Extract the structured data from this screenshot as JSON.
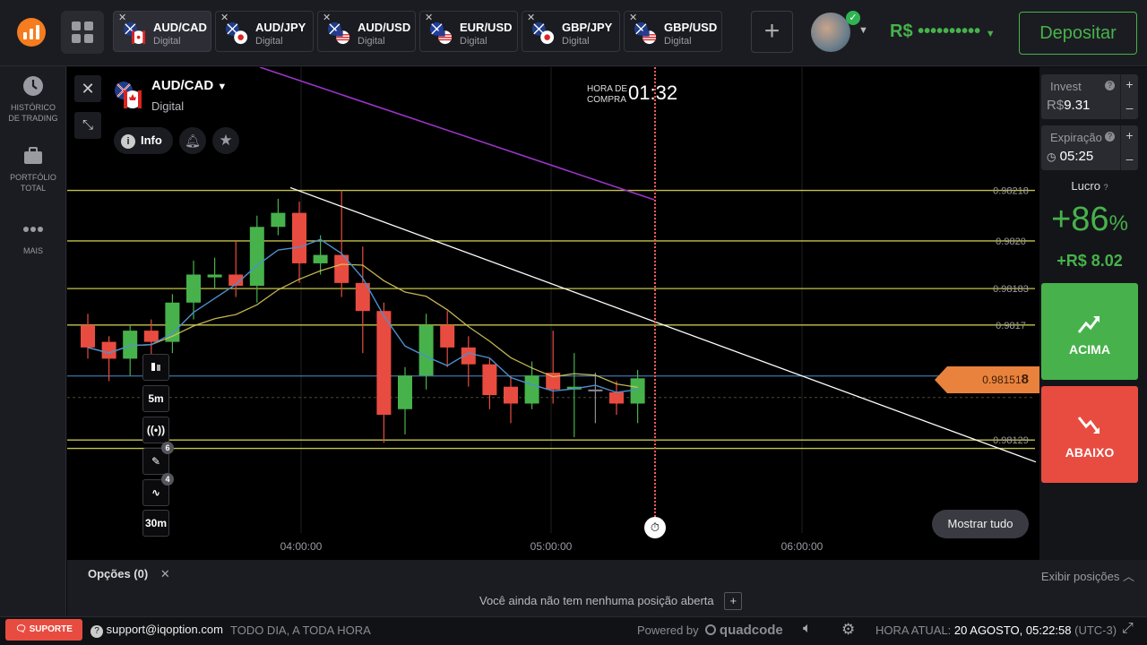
{
  "header": {
    "tabs": [
      {
        "pair": "AUD/CAD",
        "kind": "Digital",
        "active": true
      },
      {
        "pair": "AUD/JPY",
        "kind": "Digital",
        "active": false
      },
      {
        "pair": "AUD/USD",
        "kind": "Digital",
        "active": false
      },
      {
        "pair": "EUR/USD",
        "kind": "Digital",
        "active": false
      },
      {
        "pair": "GBP/JPY",
        "kind": "Digital",
        "active": false
      },
      {
        "pair": "GBP/USD",
        "kind": "Digital",
        "active": false
      }
    ],
    "balance": "R$ ••••••••••",
    "deposit_label": "Depositar"
  },
  "sidebar": {
    "items": [
      {
        "label_line1": "HISTÓRICO",
        "label_line2": "DE TRADING",
        "icon": "clock-icon"
      },
      {
        "label_line1": "PORTFÓLIO",
        "label_line2": "TOTAL",
        "icon": "briefcase-icon"
      },
      {
        "label_line1": "MAIS",
        "label_line2": "",
        "icon": "more-icon"
      }
    ]
  },
  "chart": {
    "asset": "AUD/CAD",
    "asset_kind": "Digital",
    "info_label": "Info",
    "purchase_label_1": "HORA DE",
    "purchase_label_2": "COMPRA",
    "purchase_timer": "01:32",
    "current_price_main": "0.98151",
    "current_price_bold": "8",
    "show_all_label": "Mostrar tudo",
    "time_labels": [
      "04:00:00",
      "05:00:00",
      "06:00:00"
    ],
    "price_levels": [
      "0.98218",
      "0.9820",
      "0.98183",
      "0.9817",
      "0.98129"
    ],
    "tools": [
      "5m",
      "30m"
    ],
    "tool_badges": [
      "6",
      "4"
    ]
  },
  "chart_data": {
    "type": "candlestick",
    "candles": [
      {
        "o": 0.9817,
        "c": 0.98162,
        "h": 0.98174,
        "l": 0.98158,
        "color": "red"
      },
      {
        "o": 0.98164,
        "c": 0.98158,
        "h": 0.98166,
        "l": 0.9815,
        "color": "red"
      },
      {
        "o": 0.98158,
        "c": 0.98168,
        "h": 0.9817,
        "l": 0.98152,
        "color": "green"
      },
      {
        "o": 0.98168,
        "c": 0.98164,
        "h": 0.98172,
        "l": 0.98155,
        "color": "red"
      },
      {
        "o": 0.98164,
        "c": 0.98178,
        "h": 0.98181,
        "l": 0.9816,
        "color": "green"
      },
      {
        "o": 0.98178,
        "c": 0.98188,
        "h": 0.98193,
        "l": 0.98172,
        "color": "green"
      },
      {
        "o": 0.98187,
        "c": 0.98188,
        "h": 0.98194,
        "l": 0.98183,
        "color": "green"
      },
      {
        "o": 0.98188,
        "c": 0.98184,
        "h": 0.982,
        "l": 0.9818,
        "color": "red"
      },
      {
        "o": 0.98184,
        "c": 0.98205,
        "h": 0.98209,
        "l": 0.98178,
        "color": "green"
      },
      {
        "o": 0.98205,
        "c": 0.9821,
        "h": 0.98215,
        "l": 0.98202,
        "color": "green"
      },
      {
        "o": 0.9821,
        "c": 0.98192,
        "h": 0.98214,
        "l": 0.98185,
        "color": "red"
      },
      {
        "o": 0.98192,
        "c": 0.98195,
        "h": 0.98202,
        "l": 0.98188,
        "color": "green"
      },
      {
        "o": 0.98195,
        "c": 0.98185,
        "h": 0.98218,
        "l": 0.9818,
        "color": "red"
      },
      {
        "o": 0.98185,
        "c": 0.98175,
        "h": 0.98198,
        "l": 0.9816,
        "color": "red"
      },
      {
        "o": 0.98175,
        "c": 0.98138,
        "h": 0.98178,
        "l": 0.98128,
        "color": "red"
      },
      {
        "o": 0.9814,
        "c": 0.98152,
        "h": 0.98155,
        "l": 0.98131,
        "color": "green"
      },
      {
        "o": 0.98152,
        "c": 0.9817,
        "h": 0.98174,
        "l": 0.98147,
        "color": "green"
      },
      {
        "o": 0.9817,
        "c": 0.98162,
        "h": 0.98175,
        "l": 0.98155,
        "color": "red"
      },
      {
        "o": 0.98162,
        "c": 0.98156,
        "h": 0.98166,
        "l": 0.98148,
        "color": "red"
      },
      {
        "o": 0.98156,
        "c": 0.98145,
        "h": 0.98158,
        "l": 0.9814,
        "color": "red"
      },
      {
        "o": 0.98148,
        "c": 0.98142,
        "h": 0.98152,
        "l": 0.98135,
        "color": "red"
      },
      {
        "o": 0.98142,
        "c": 0.98152,
        "h": 0.98157,
        "l": 0.9814,
        "color": "green"
      },
      {
        "o": 0.98153,
        "c": 0.98147,
        "h": 0.98168,
        "l": 0.98142,
        "color": "red"
      },
      {
        "o": 0.98147,
        "c": 0.98148,
        "h": 0.9816,
        "l": 0.9813,
        "color": "green"
      },
      {
        "o": 0.98147,
        "c": 0.98147,
        "h": 0.98153,
        "l": 0.98135,
        "color": "gray"
      },
      {
        "o": 0.98146,
        "c": 0.98142,
        "h": 0.9815,
        "l": 0.98138,
        "color": "red"
      },
      {
        "o": 0.98142,
        "c": 0.98151,
        "h": 0.98154,
        "l": 0.98135,
        "color": "green"
      }
    ],
    "ylim": [
      0.98115,
      0.9823
    ],
    "xlim": [
      "03:35:00",
      "06:15:00"
    ],
    "x_ticks": [
      "04:00:00",
      "05:00:00",
      "06:00:00"
    ],
    "current_price": 0.981518,
    "horizontal_levels": [
      0.98218,
      0.982,
      0.98183,
      0.9817,
      0.98129,
      0.98126
    ],
    "colors": {
      "up": "#47b24b",
      "down": "#e84c40",
      "level": "#e5e55a",
      "ma_fast": "#4a8fd0",
      "ma_slow": "#d8c75a",
      "trend": "#ffffff",
      "purple": "#9a35c8",
      "price_tag": "#e9823c"
    }
  },
  "trade_panel": {
    "invest_label": "Invest",
    "invest_currency": "R$",
    "invest_value": "9.31",
    "expiry_label": "Expiração",
    "expiry_value": "05:25",
    "profit_label": "Lucro",
    "profit_pct": "+86",
    "profit_pct_sign": "%",
    "profit_amount": "+R$ 8.02",
    "up_label": "ACIMA",
    "down_label": "ABAIXO"
  },
  "positions": {
    "title": "Opções (0)",
    "show_positions": "Exibir posições",
    "empty_text": "Você ainda não tem nenhuma posição aberta"
  },
  "footer": {
    "support_label": "SUPORTE",
    "email": "support@iqoption.com",
    "hours": "TODO DIA, A TODA HORA",
    "powered_by": "Powered by",
    "brand": "quadcode",
    "time_label": "HORA ATUAL:",
    "time_value": "20 AGOSTO, 05:22:58",
    "timezone": "(UTC-3)"
  }
}
